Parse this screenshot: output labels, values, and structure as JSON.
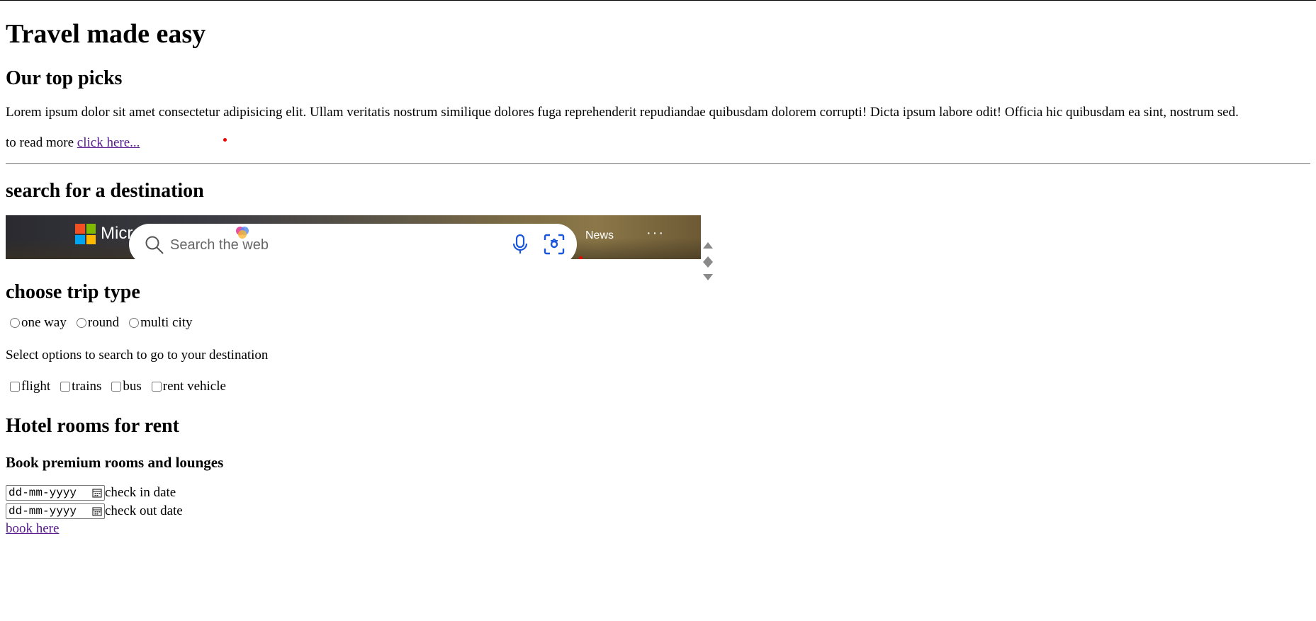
{
  "header": {
    "title": "Travel made easy"
  },
  "top_picks": {
    "heading": "Our top picks",
    "paragraph": "Lorem ipsum dolor sit amet consectetur adipisicing elit. Ullam veritatis nostrum similique dolores fuga reprehenderit repudiandae quibusdam dolorem corrupti! Dicta ipsum labore odit! Officia hic quibusdam ea sint, nostrum sed.",
    "read_more_prefix": "to read more ",
    "read_more_link": "click here..."
  },
  "search": {
    "heading": "search for a destination",
    "embed": {
      "brand": "Microsoft Bing",
      "placeholder": "Search the web",
      "news": "News",
      "more": "···"
    }
  },
  "trip_type": {
    "heading": "choose trip type",
    "options": [
      "one way",
      "round",
      "multi city"
    ]
  },
  "transport": {
    "prompt": "Select options to search to go to your destination",
    "options": [
      "flight",
      "trains",
      "bus",
      "rent vehicle"
    ]
  },
  "hotel": {
    "heading": "Hotel rooms for rent",
    "subheading": "Book premium rooms and lounges",
    "checkin_placeholder": "dd-mm-yyyy",
    "checkin_label": "check in date",
    "checkout_placeholder": "dd-mm-yyyy",
    "checkout_label": "check out date",
    "book_link": "book here"
  },
  "colors": {
    "link": "#551a8b",
    "bing_red": "#f25022",
    "bing_green": "#7fba00",
    "bing_blue": "#00a4ef",
    "bing_yellow": "#ffb900",
    "icon_blue": "#1a56db"
  }
}
